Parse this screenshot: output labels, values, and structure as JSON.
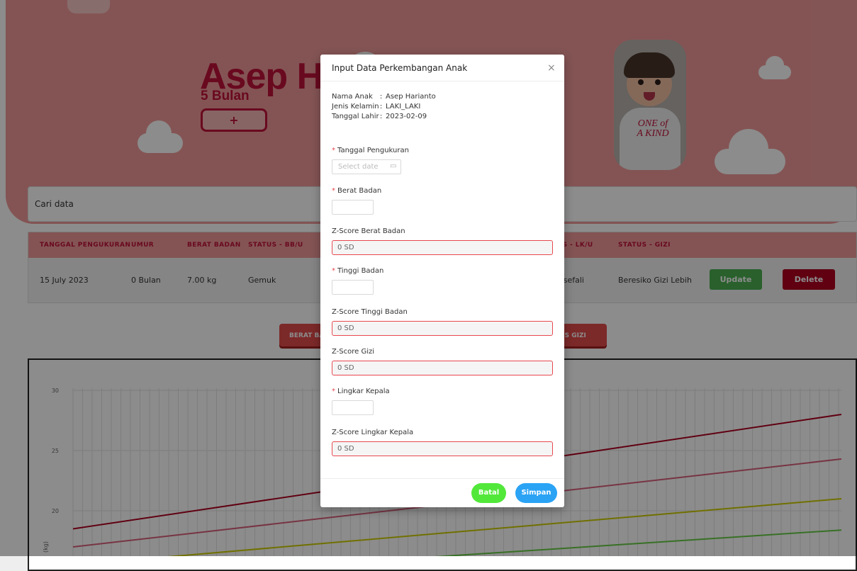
{
  "header": {
    "child_name": "Asep Harianto",
    "age": "5 Bulan",
    "add_label": "+"
  },
  "search": {
    "placeholder": "Cari data"
  },
  "table": {
    "headers": [
      "TANGGAL PENGUKURAN",
      "UMUR",
      "BERAT BADAN",
      "STATUS - BB/U",
      "STATUS - LK/U",
      "STATUS - GIZI"
    ],
    "rows": [
      {
        "tanggal": "15 July 2023",
        "umur": "0 Bulan",
        "berat": "7.00 kg",
        "status_bbu": "Gemuk",
        "status_lku": "Normosefali",
        "status_gizi": "Beresiko Gizi Lebih"
      }
    ],
    "update_label": "Update",
    "delete_label": "Delete"
  },
  "chart_tabs": [
    "BERAT BADAN",
    "STATUS GIZI"
  ],
  "chart_data": {
    "type": "line",
    "y_ticks": [
      "30",
      "25",
      "20"
    ],
    "ylabel": "(kg)",
    "ylim": [
      18,
      31
    ],
    "x": [
      0,
      1
    ],
    "series": [
      {
        "values": [
          18.5,
          28.0
        ],
        "color": "#b00020"
      },
      {
        "values": [
          17.0,
          24.3
        ],
        "color": "#d9607a"
      },
      {
        "values": [
          15.5,
          21.0
        ],
        "color": "#cccc00"
      },
      {
        "values": [
          14.2,
          18.4
        ],
        "color": "#66cc44"
      }
    ]
  },
  "modal": {
    "title": "Input Data Perkembangan Anak",
    "close": "×",
    "info": [
      {
        "key": "Nama Anak",
        "value": "Asep Harianto"
      },
      {
        "key": "Jenis Kelamin",
        "value": "LAKI_LAKI"
      },
      {
        "key": "Tanggal Lahir",
        "value": "2023-02-09"
      }
    ],
    "tanggal_label": "Tanggal Pengukuran",
    "date_placeholder": "Select date",
    "berat_label": "Berat Badan",
    "z_berat_label": "Z-Score Berat Badan",
    "z_berat_value": "0 SD",
    "tinggi_label": "Tinggi Badan",
    "z_tinggi_label": "Z-Score Tinggi Badan",
    "z_tinggi_value": "0 SD",
    "z_gizi_label": "Z-Score Gizi",
    "z_gizi_value": "0 SD",
    "lingkar_label": "Lingkar Kepala",
    "z_lingkar_label": "Z-Score Lingkar Kepala",
    "z_lingkar_value": "0 SD",
    "required_mark": "*",
    "batal_label": "Batal",
    "simpan_label": "Simpan"
  },
  "photo_text": "ONE of A KIND",
  "colors": {
    "brand": "#c0123a",
    "hero_bg": "#f09a9a",
    "required": "#e8484f"
  }
}
